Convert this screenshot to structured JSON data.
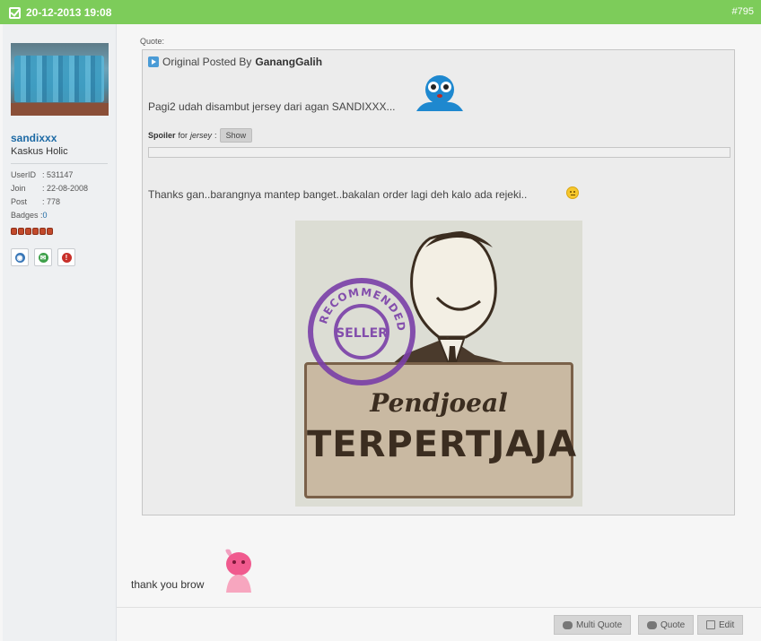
{
  "header": {
    "date": "20-12-2013 19:08",
    "post_number": "#795",
    "accent_color": "#7dcc5a"
  },
  "user": {
    "name": "sandixxx",
    "title": "Kaskus Holic",
    "stats": [
      {
        "key": "UserID",
        "value": ": 531147"
      },
      {
        "key": "Join",
        "value": ": 22-08-2008"
      },
      {
        "key": "Post",
        "value": ": 778"
      }
    ],
    "badges_label": "Badges : ",
    "badges_value": "0",
    "reputation_dots": 6,
    "actions": [
      "profile-icon",
      "message-icon",
      "report-icon"
    ]
  },
  "quote": {
    "label": "Quote:",
    "header_prefix": "Original Posted By",
    "author": "GanangGalih",
    "line1": "Pagi2 udah disambut jersey dari agan SANDIXXX...",
    "spoiler_label": "Spoiler",
    "spoiler_for": "for",
    "spoiler_topic": "jersey",
    "spoiler_button": "Show",
    "line2": "Thanks gan..barangnya mantep banget..bakalan order lagi deh kalo ada rejeki..",
    "poster": {
      "line1": "Pendjoeal",
      "line2": "TERPERTJAJA",
      "stamp_top": "RECOMMENDED",
      "stamp_center": "SELLER"
    }
  },
  "message": "thank you brow",
  "footer": {
    "multi_quote": "Multi Quote",
    "quote": "Quote",
    "edit": "Edit"
  }
}
